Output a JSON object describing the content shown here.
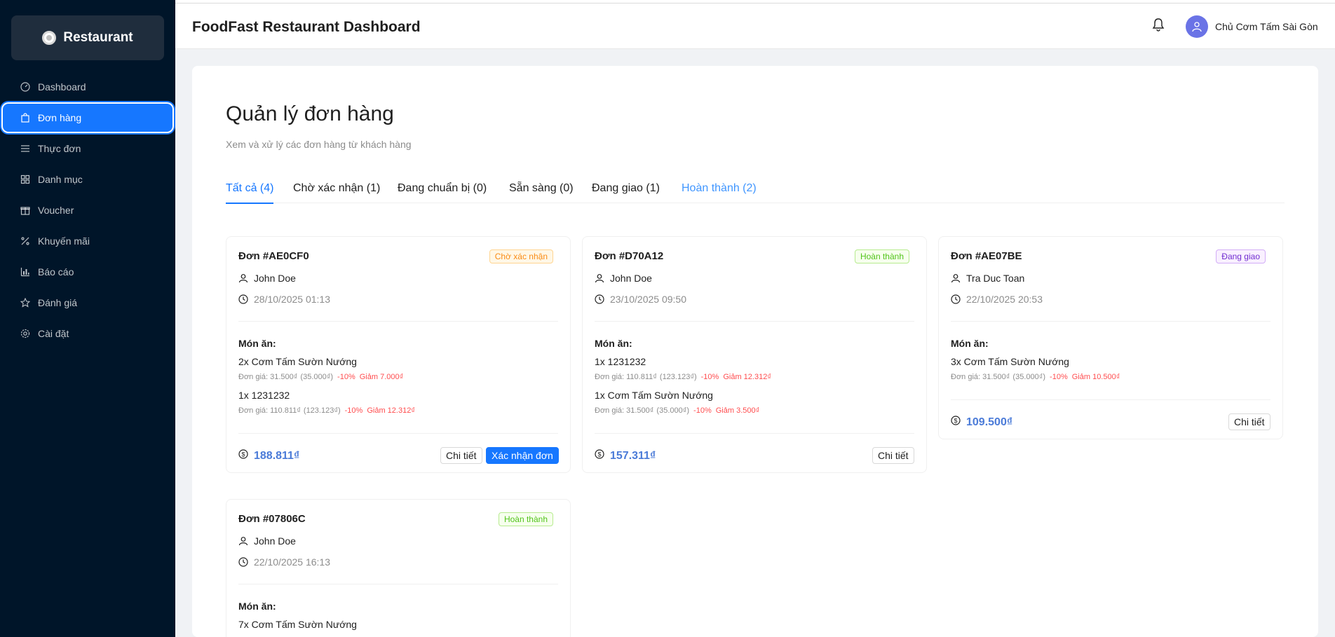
{
  "sidebar": {
    "brand": "Restaurant",
    "items": [
      {
        "label": "Dashboard",
        "icon": "dashboard-icon"
      },
      {
        "label": "Đơn hàng",
        "icon": "shopping-bag-icon",
        "active": true
      },
      {
        "label": "Thực đơn",
        "icon": "menu-icon"
      },
      {
        "label": "Danh mục",
        "icon": "grid-icon"
      },
      {
        "label": "Voucher",
        "icon": "gift-icon"
      },
      {
        "label": "Khuyến mãi",
        "icon": "percent-icon"
      },
      {
        "label": "Báo cáo",
        "icon": "bar-chart-icon"
      },
      {
        "label": "Đánh giá",
        "icon": "star-icon"
      },
      {
        "label": "Cài đặt",
        "icon": "settings-icon"
      }
    ]
  },
  "header": {
    "title": "FoodFast Restaurant Dashboard",
    "user_name": "Chủ Cơm Tấm Sài Gòn"
  },
  "page": {
    "title": "Quản lý đơn hàng",
    "subtitle": "Xem và xử lý các đơn hàng từ khách hàng"
  },
  "tabs": [
    {
      "label": "Tất cả (4)",
      "state": "active"
    },
    {
      "label": "Chờ xác nhận (1)",
      "state": "normal"
    },
    {
      "label": "Đang chuẩn bị (0)",
      "state": "normal"
    },
    {
      "label": "Sẵn sàng (0)",
      "state": "normal"
    },
    {
      "label": "Đang giao (1)",
      "state": "normal"
    },
    {
      "label": "Hoàn thành (2)",
      "state": "done"
    }
  ],
  "labels": {
    "items": "Món ăn:",
    "detail": "Chi tiết",
    "confirm": "Xác nhận đơn"
  },
  "orders": [
    {
      "code": "Đơn #AE0CF0",
      "status": "Chờ xác nhận",
      "customer": "John Doe",
      "time": "28/10/2025 01:13",
      "items": [
        {
          "name": "2x Cơm Tấm Sườn Nướng",
          "unit": "Đơn giá: 31.500₫",
          "orig": "(35.000₫)",
          "discount": "-10%",
          "saving": "Giảm 7.000₫"
        },
        {
          "name": "1x 1231232",
          "unit": "Đơn giá: 110.811₫",
          "orig": "(123.123₫)",
          "discount": "-10%",
          "saving": "Giảm 12.312₫"
        }
      ],
      "total": "188.811₫"
    },
    {
      "code": "Đơn #D70A12",
      "status": "Hoàn thành",
      "customer": "John Doe",
      "time": "23/10/2025 09:50",
      "items": [
        {
          "name": "1x 1231232",
          "unit": "Đơn giá: 110.811₫",
          "orig": "(123.123₫)",
          "discount": "-10%",
          "saving": "Giảm 12.312₫"
        },
        {
          "name": "1x Cơm Tấm Sườn Nướng",
          "unit": "Đơn giá: 31.500₫",
          "orig": "(35.000₫)",
          "discount": "-10%",
          "saving": "Giảm 3.500₫"
        }
      ],
      "total": "157.311₫"
    },
    {
      "code": "Đơn #AE07BE",
      "status": "Đang giao",
      "customer": "Tra Duc Toan",
      "time": "22/10/2025 20:53",
      "items": [
        {
          "name": "3x Cơm Tấm Sườn Nướng",
          "unit": "Đơn giá: 31.500₫",
          "orig": "(35.000₫)",
          "discount": "-10%",
          "saving": "Giảm 10.500₫"
        }
      ],
      "total": "109.500₫"
    },
    {
      "code": "Đơn #07806C",
      "status": "Hoàn thành",
      "customer": "John Doe",
      "time": "22/10/2025 16:13",
      "items": [
        {
          "name": "7x Cơm Tấm Sườn Nướng"
        }
      ]
    }
  ],
  "colors": {
    "sidebar_bg": "#001529",
    "primary": "#1677ff",
    "total": "#4b7bd8",
    "discount": "#ff4d4f"
  }
}
